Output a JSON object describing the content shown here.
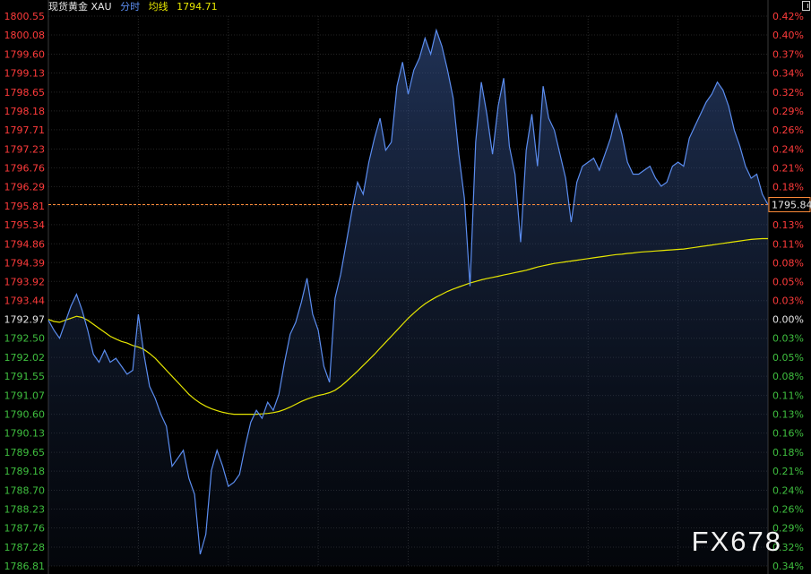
{
  "header": {
    "ticker": "现货黄金 XAU",
    "mode": "分时",
    "avg_label": "均线",
    "avg_value": "1794.71"
  },
  "watermark": "FX678",
  "colors": {
    "background": "#000000",
    "price_line": "#5b8df0",
    "average_line": "#e6e600",
    "up": "#ff3b3b",
    "down": "#3fbf3f",
    "neutral": "#e6e6e6",
    "ref_line": "#ff8c3a"
  },
  "chart_data": {
    "type": "line",
    "title": "",
    "xlabel": "",
    "ylabel": "",
    "ylim": [
      1786.81,
      1800.55
    ],
    "reference_price": 1792.97,
    "current_price": "1795.84",
    "y_ticks": [
      "1800.55",
      "1800.08",
      "1799.60",
      "1799.13",
      "1798.65",
      "1798.18",
      "1797.71",
      "1797.23",
      "1796.76",
      "1796.29",
      "1795.81",
      "1795.34",
      "1794.86",
      "1794.39",
      "1793.92",
      "1793.44",
      "1792.97",
      "1792.50",
      "1792.02",
      "1791.55",
      "1791.07",
      "1790.60",
      "1790.13",
      "1789.65",
      "1789.18",
      "1788.70",
      "1788.23",
      "1787.76",
      "1787.28",
      "1786.81"
    ],
    "pct_ticks": [
      "0.42%",
      "0.40%",
      "0.37%",
      "0.34%",
      "0.32%",
      "0.29%",
      "0.26%",
      "0.24%",
      "0.21%",
      "0.18%",
      "0.16%",
      "0.13%",
      "0.11%",
      "0.08%",
      "0.05%",
      "0.03%",
      "0.00%",
      "0.03%",
      "0.05%",
      "0.08%",
      "0.11%",
      "0.13%",
      "0.16%",
      "0.18%",
      "0.21%",
      "0.24%",
      "0.26%",
      "0.29%",
      "0.32%",
      "0.34%"
    ],
    "series": [
      {
        "values": [
          1792.95,
          1792.7,
          1792.5,
          1792.9,
          1793.3,
          1793.6,
          1793.2,
          1792.7,
          1792.1,
          1791.9,
          1792.2,
          1791.9,
          1792.0,
          1791.8,
          1791.6,
          1791.7,
          1793.1,
          1792.1,
          1791.3,
          1791.0,
          1790.6,
          1790.3,
          1789.3,
          1789.5,
          1789.7,
          1789.0,
          1788.6,
          1787.1,
          1787.6,
          1789.2,
          1789.7,
          1789.3,
          1788.8,
          1788.9,
          1789.1,
          1789.8,
          1790.4,
          1790.7,
          1790.5,
          1790.9,
          1790.7,
          1791.1,
          1791.9,
          1792.6,
          1792.9,
          1793.4,
          1794.0,
          1793.1,
          1792.7,
          1791.8,
          1791.4,
          1793.5,
          1794.1,
          1794.9,
          1795.7,
          1796.4,
          1796.1,
          1796.9,
          1797.5,
          1798.0,
          1797.2,
          1797.4,
          1798.8,
          1799.4,
          1798.6,
          1799.2,
          1799.5,
          1800.0,
          1799.6,
          1800.2,
          1799.8,
          1799.2,
          1798.5,
          1797.1,
          1796.0,
          1793.8,
          1797.4,
          1798.9,
          1798.1,
          1797.1,
          1798.3,
          1799.0,
          1797.3,
          1796.6,
          1794.9,
          1797.2,
          1798.1,
          1796.8,
          1798.8,
          1798.0,
          1797.7,
          1797.1,
          1796.5,
          1795.4,
          1796.4,
          1796.8,
          1796.9,
          1797.0,
          1796.7,
          1797.1,
          1797.5,
          1798.1,
          1797.6,
          1796.9,
          1796.6,
          1796.6,
          1796.7,
          1796.8,
          1796.5,
          1796.3,
          1796.4,
          1796.8,
          1796.9,
          1796.8,
          1797.5,
          1797.8,
          1798.1,
          1798.4,
          1798.6,
          1798.9,
          1798.7,
          1798.3,
          1797.7,
          1797.3,
          1796.8,
          1796.5,
          1796.6,
          1796.1,
          1795.84
        ],
        "color": "#5b8df0"
      },
      {
        "values": [
          1792.97,
          1792.92,
          1792.9,
          1792.95,
          1793.0,
          1793.05,
          1793.02,
          1792.95,
          1792.85,
          1792.75,
          1792.65,
          1792.55,
          1792.48,
          1792.42,
          1792.38,
          1792.32,
          1792.28,
          1792.22,
          1792.12,
          1792.0,
          1791.85,
          1791.7,
          1791.55,
          1791.4,
          1791.25,
          1791.1,
          1790.98,
          1790.88,
          1790.8,
          1790.74,
          1790.69,
          1790.65,
          1790.62,
          1790.6,
          1790.6,
          1790.6,
          1790.6,
          1790.6,
          1790.61,
          1790.62,
          1790.64,
          1790.67,
          1790.72,
          1790.78,
          1790.85,
          1790.92,
          1790.98,
          1791.03,
          1791.07,
          1791.1,
          1791.14,
          1791.2,
          1791.3,
          1791.42,
          1791.55,
          1791.68,
          1791.82,
          1791.96,
          1792.1,
          1792.25,
          1792.4,
          1792.55,
          1792.7,
          1792.85,
          1793.0,
          1793.13,
          1793.25,
          1793.36,
          1793.45,
          1793.53,
          1793.6,
          1793.67,
          1793.73,
          1793.78,
          1793.83,
          1793.88,
          1793.92,
          1793.96,
          1793.99,
          1794.02,
          1794.05,
          1794.08,
          1794.11,
          1794.14,
          1794.17,
          1794.2,
          1794.24,
          1794.28,
          1794.31,
          1794.34,
          1794.37,
          1794.39,
          1794.41,
          1794.43,
          1794.45,
          1794.47,
          1794.49,
          1794.51,
          1794.53,
          1794.55,
          1794.57,
          1794.59,
          1794.6,
          1794.62,
          1794.63,
          1794.65,
          1794.66,
          1794.67,
          1794.68,
          1794.69,
          1794.7,
          1794.71,
          1794.72,
          1794.73,
          1794.75,
          1794.77,
          1794.79,
          1794.81,
          1794.83,
          1794.85,
          1794.87,
          1794.89,
          1794.91,
          1794.93,
          1794.95,
          1794.97,
          1794.98,
          1794.99,
          1794.99
        ],
        "color": "#e6e600"
      }
    ]
  }
}
